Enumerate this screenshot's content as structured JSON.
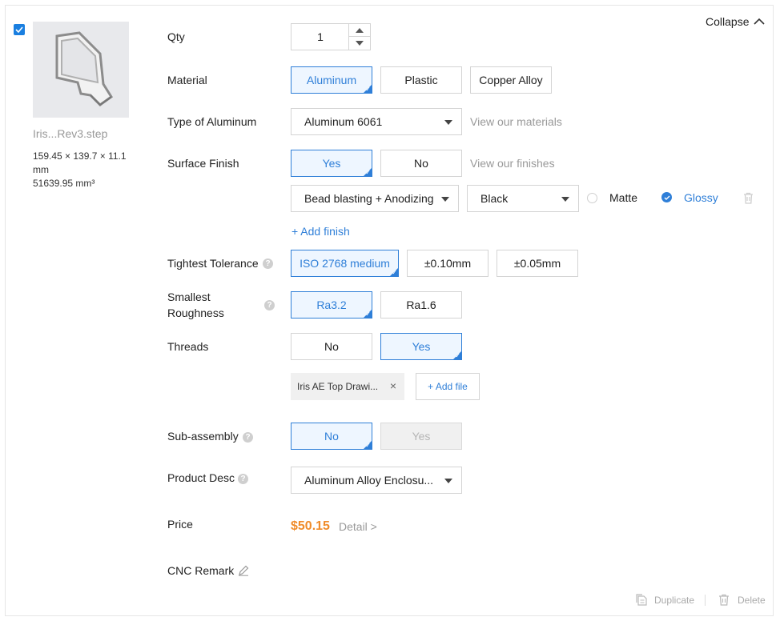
{
  "collapse_label": "Collapse",
  "part": {
    "filename": "Iris...Rev3.step",
    "dimensions": "159.45 × 139.7 × 11.1 mm",
    "volume": "51639.95 mm³"
  },
  "qty": {
    "label": "Qty",
    "value": "1"
  },
  "material": {
    "label": "Material",
    "options": [
      "Aluminum",
      "Plastic",
      "Copper Alloy"
    ],
    "selected": "Aluminum"
  },
  "type": {
    "label": "Type of Aluminum",
    "value": "Aluminum 6061",
    "link": "View our materials"
  },
  "surface": {
    "label": "Surface Finish",
    "options": [
      "Yes",
      "No"
    ],
    "selected": "Yes",
    "link": "View our finishes",
    "finish_value": "Bead blasting + Anodizing",
    "color_value": "Black",
    "matte_label": "Matte",
    "glossy_label": "Glossy",
    "selected_sheen": "Glossy",
    "add_finish": "+ Add finish"
  },
  "tolerance": {
    "label": "Tightest Tolerance",
    "options": [
      "ISO 2768 medium",
      "±0.10mm",
      "±0.05mm"
    ],
    "selected": "ISO 2768 medium"
  },
  "roughness": {
    "label_line1": "Smallest",
    "label_line2": "Roughness",
    "options": [
      "Ra3.2",
      "Ra1.6"
    ],
    "selected": "Ra3.2"
  },
  "threads": {
    "label": "Threads",
    "options": [
      "No",
      "Yes"
    ],
    "selected": "Yes",
    "file_name": "Iris AE Top Drawi...",
    "add_file": "+ Add file"
  },
  "subassembly": {
    "label": "Sub-assembly",
    "options": [
      "No",
      "Yes"
    ],
    "selected": "No"
  },
  "product_desc": {
    "label": "Product Desc",
    "value": "Aluminum Alloy Enclosu..."
  },
  "price": {
    "label": "Price",
    "value": "$50.15",
    "detail": "Detail >"
  },
  "remark": {
    "label": "CNC Remark"
  },
  "footer": {
    "duplicate": "Duplicate",
    "delete": "Delete"
  },
  "colors": {
    "accent": "#2f7fd8",
    "price": "#f08c2a",
    "checkbox": "#1a7fe0"
  }
}
